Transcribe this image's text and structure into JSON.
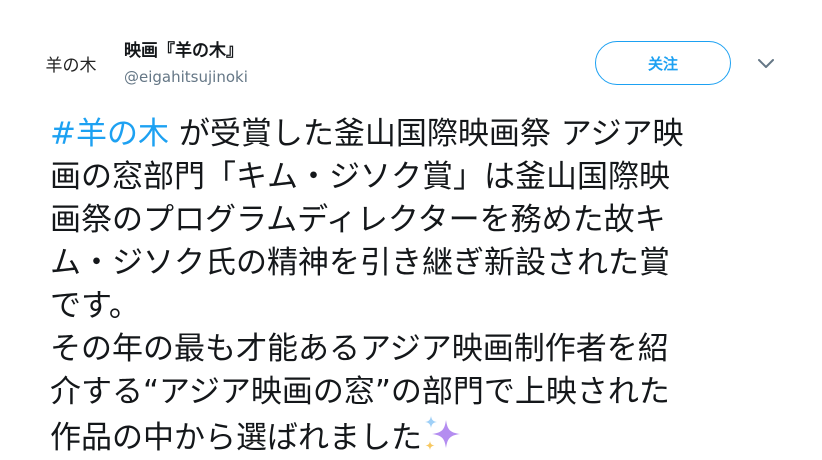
{
  "account": {
    "avatar_text": "羊の木",
    "display_name": "映画『羊の木』",
    "handle": "@eigahitsujinoki"
  },
  "actions": {
    "follow_label": "关注",
    "more_icon": "chevron-down-icon"
  },
  "tweet": {
    "hashtag": "#羊の木",
    "line1_rest": " が受賞した釜山国際映画祭 アジア映",
    "line2": "画の窓部門「キム・ジソク賞」は釜山国際映",
    "line3": "画祭のプログラムディレクターを務めた故キ",
    "line4": "ム・ジソク氏の精神を引き継ぎ新設された賞",
    "line5": "です。",
    "line6": "その年の最も才能あるアジア映画制作者を紹",
    "line7": "介する“アジア映画の窓”の部門で上映された",
    "line8": "作品の中から選ばれました",
    "emoji": "sparkles-icon"
  },
  "colors": {
    "accent": "#1da1f2",
    "text": "#14171a",
    "secondary": "#657786",
    "sparkle": "#b48df0"
  }
}
